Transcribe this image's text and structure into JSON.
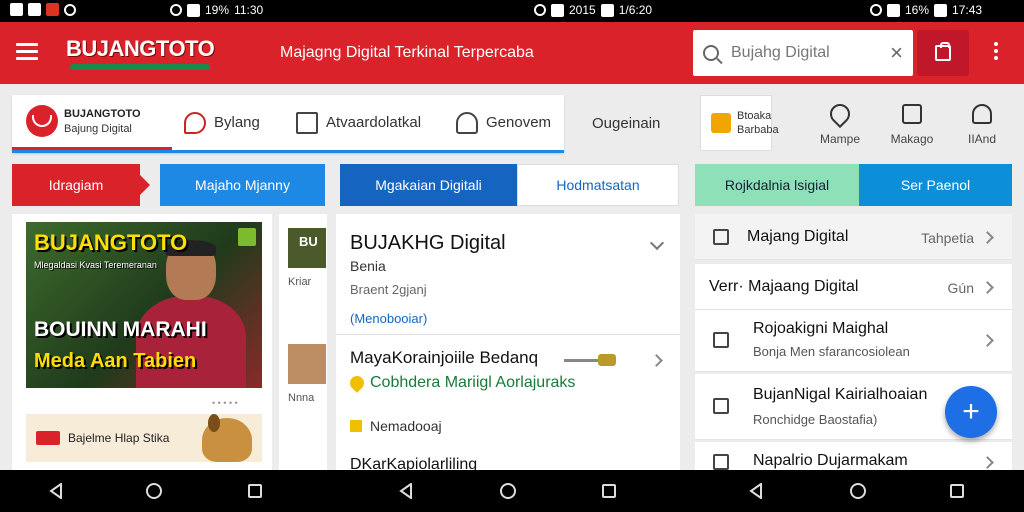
{
  "status_bar": {
    "segments": [
      {
        "battery": "19%",
        "time": "11:30"
      },
      {
        "battery": "2015",
        "time": "1/6:20"
      },
      {
        "battery": "16%",
        "time": "17:43"
      }
    ]
  },
  "app_bar": {
    "brand": "BUJANGTOTO",
    "tagline": "Majagng Digital Terkinal Terpercaba",
    "search_value": "Bujahg Digital",
    "accent": "#d9222a"
  },
  "tabs": {
    "logo_name": "BUJANGTOTO",
    "logo_sub": "Bajung Digital",
    "items": [
      "Bylang",
      "Atvaardolatkal",
      "Genovem"
    ],
    "extra": "Ougeinain"
  },
  "tiles": {
    "main_lines": [
      "Btoaka",
      "Barbaba"
    ],
    "items": [
      "Mampe",
      "Makago",
      "IIAnd"
    ]
  },
  "categories": {
    "red": "Idragiam",
    "blue1": "Majaho Mjanny",
    "blue2": "Mgakaian Digitali",
    "white": "Hodmatsatan",
    "green": "Rojkdalnia lsigial",
    "blue3": "Ser Paenol"
  },
  "banner": {
    "title": "BUJANGTOTO",
    "subtitle": "Mlegaldasi Kvasi Teremeranan",
    "line1": "BOUINN MARAHI",
    "line2": "Meda Aan Tabien",
    "dots": "• • • • •",
    "promo_text": "Bajelme Hlap Stika"
  },
  "thumbs": [
    {
      "title": "BU",
      "caption": "Kriar"
    },
    {
      "caption": "Nnna"
    }
  ],
  "middle": {
    "header": "BUJAKHG Digital",
    "subheader": "Benia",
    "meta": "Braent 2gjanj",
    "link": "(Menobooiar)",
    "item2_title": "MayaKorainjoiile Bedanq",
    "item2_sub": "Cobhdera Mariigl Aorlajuraks",
    "item3": "Nemadooaj",
    "item4": "DKarKapiolarliling"
  },
  "right_list": [
    {
      "title": "Majang Digital",
      "right": "Tahpetia"
    },
    {
      "title": "Verr· Majaang Digital",
      "right": "Gún"
    },
    {
      "title": "Rojoakigni Maighal",
      "sub": "Bonja Men sfarancosiolean"
    },
    {
      "title": "BujanNigal Kairialhoaian",
      "sub": "Ronchidge Baostafia)"
    },
    {
      "title": "Napalrio Dujarmakam"
    }
  ],
  "fab_label": "+"
}
